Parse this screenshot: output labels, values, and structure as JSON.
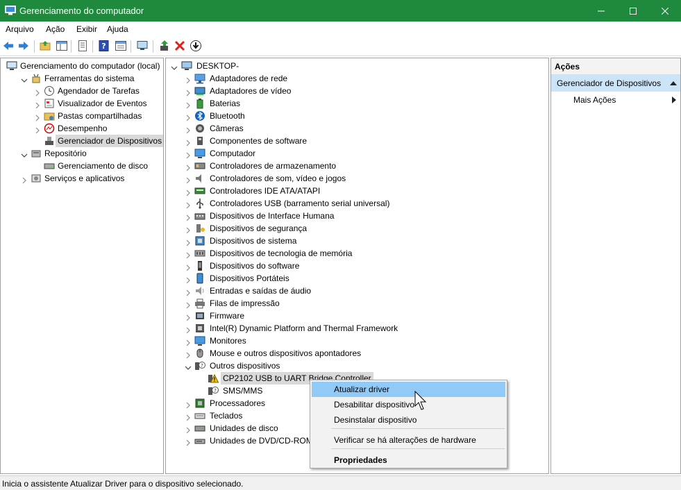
{
  "window": {
    "title": "Gerenciamento do computador",
    "controls": [
      "minimize-icon",
      "maximize-icon",
      "close-icon"
    ]
  },
  "menu": [
    "Arquivo",
    "Ação",
    "Exibir",
    "Ajuda"
  ],
  "toolbar": [
    "back-icon",
    "forward-icon",
    "up-folder-icon",
    "show-hide-tree-icon",
    "export-list-icon",
    "help-icon",
    "properties-icon",
    "scan-monitor-icon",
    "update-driver-icon",
    "uninstall-icon",
    "download-icon"
  ],
  "left_tree": {
    "items": [
      {
        "label": "Gerenciamento do computador (local)",
        "level": 0,
        "chevron": "none",
        "icon": "computer-management-icon"
      },
      {
        "label": "Ferramentas do sistema",
        "level": 1,
        "chevron": "expanded",
        "icon": "tools-icon"
      },
      {
        "label": "Agendador de Tarefas",
        "level": 2,
        "chevron": "collapsed",
        "icon": "clock-icon"
      },
      {
        "label": "Visualizador de Eventos",
        "level": 2,
        "chevron": "collapsed",
        "icon": "event-viewer-icon"
      },
      {
        "label": "Pastas compartilhadas",
        "level": 2,
        "chevron": "collapsed",
        "icon": "shared-folder-icon"
      },
      {
        "label": "Desempenho",
        "level": 2,
        "chevron": "collapsed",
        "icon": "performance-icon"
      },
      {
        "label": "Gerenciador de Dispositivos",
        "level": 2,
        "chevron": "none",
        "icon": "device-manager-icon",
        "selected": true
      },
      {
        "label": "Repositório",
        "level": 1,
        "chevron": "expanded",
        "icon": "storage-icon"
      },
      {
        "label": "Gerenciamento de disco",
        "level": 2,
        "chevron": "none",
        "icon": "disk-icon"
      },
      {
        "label": "Serviços e aplicativos",
        "level": 1,
        "chevron": "collapsed",
        "icon": "services-icon"
      }
    ]
  },
  "device_tree": {
    "root": "DESKTOP-",
    "items": [
      {
        "label": "Adaptadores de rede",
        "level": 1,
        "chevron": "collapsed",
        "icon": "network-adapter-icon"
      },
      {
        "label": "Adaptadores de vídeo",
        "level": 1,
        "chevron": "collapsed",
        "icon": "display-adapter-icon"
      },
      {
        "label": "Baterias",
        "level": 1,
        "chevron": "collapsed",
        "icon": "battery-icon"
      },
      {
        "label": "Bluetooth",
        "level": 1,
        "chevron": "collapsed",
        "icon": "bluetooth-icon"
      },
      {
        "label": "Câmeras",
        "level": 1,
        "chevron": "collapsed",
        "icon": "camera-icon"
      },
      {
        "label": "Componentes de software",
        "level": 1,
        "chevron": "collapsed",
        "icon": "software-component-icon"
      },
      {
        "label": "Computador",
        "level": 1,
        "chevron": "collapsed",
        "icon": "monitor-icon"
      },
      {
        "label": "Controladores de armazenamento",
        "level": 1,
        "chevron": "collapsed",
        "icon": "storage-controller-icon"
      },
      {
        "label": "Controladores de som, vídeo e jogos",
        "level": 1,
        "chevron": "collapsed",
        "icon": "speaker-icon"
      },
      {
        "label": "Controladores IDE ATA/ATAPI",
        "level": 1,
        "chevron": "collapsed",
        "icon": "ide-controller-icon"
      },
      {
        "label": "Controladores USB (barramento serial universal)",
        "level": 1,
        "chevron": "collapsed",
        "icon": "usb-icon"
      },
      {
        "label": "Dispositivos de Interface Humana",
        "level": 1,
        "chevron": "collapsed",
        "icon": "hid-icon"
      },
      {
        "label": "Dispositivos de segurança",
        "level": 1,
        "chevron": "collapsed",
        "icon": "security-device-icon"
      },
      {
        "label": "Dispositivos de sistema",
        "level": 1,
        "chevron": "collapsed",
        "icon": "system-device-icon"
      },
      {
        "label": "Dispositivos de tecnologia de memória",
        "level": 1,
        "chevron": "collapsed",
        "icon": "memory-device-icon"
      },
      {
        "label": "Dispositivos do software",
        "level": 1,
        "chevron": "collapsed",
        "icon": "software-device-icon"
      },
      {
        "label": "Dispositivos Portáteis",
        "level": 1,
        "chevron": "collapsed",
        "icon": "portable-device-icon"
      },
      {
        "label": "Entradas e saídas de áudio",
        "level": 1,
        "chevron": "collapsed",
        "icon": "audio-io-icon"
      },
      {
        "label": "Filas de impressão",
        "level": 1,
        "chevron": "collapsed",
        "icon": "printer-icon"
      },
      {
        "label": "Firmware",
        "level": 1,
        "chevron": "collapsed",
        "icon": "firmware-icon"
      },
      {
        "label": "Intel(R) Dynamic Platform and Thermal Framework",
        "level": 1,
        "chevron": "collapsed",
        "icon": "thermal-framework-icon"
      },
      {
        "label": "Monitores",
        "level": 1,
        "chevron": "collapsed",
        "icon": "monitor-icon"
      },
      {
        "label": "Mouse e outros dispositivos apontadores",
        "level": 1,
        "chevron": "collapsed",
        "icon": "mouse-icon"
      },
      {
        "label": "Outros dispositivos",
        "level": 1,
        "chevron": "expanded",
        "icon": "unknown-device-icon"
      },
      {
        "label": "CP2102 USB to UART Bridge Controller",
        "level": 2,
        "chevron": "none",
        "icon": "warning-device-icon",
        "selected": true
      },
      {
        "label": "SMS/MMS",
        "level": 2,
        "chevron": "none",
        "icon": "unknown-device-icon"
      },
      {
        "label": "Processadores",
        "level": 1,
        "chevron": "collapsed",
        "icon": "processor-icon"
      },
      {
        "label": "Teclados",
        "level": 1,
        "chevron": "collapsed",
        "icon": "keyboard-icon"
      },
      {
        "label": "Unidades de disco",
        "level": 1,
        "chevron": "collapsed",
        "icon": "disk-drive-icon"
      },
      {
        "label": "Unidades de DVD/CD-ROM",
        "level": 1,
        "chevron": "collapsed",
        "icon": "dvd-drive-icon"
      }
    ]
  },
  "actions": {
    "header": "Ações",
    "section": "Gerenciador de Dispositivos",
    "more": "Mais Ações"
  },
  "context_menu": {
    "items": [
      {
        "label": "Atualizar driver",
        "highlighted": true
      },
      {
        "label": "Desabilitar dispositivo"
      },
      {
        "label": "Desinstalar dispositivo"
      },
      {
        "label": "Verificar se há alterações de hardware"
      },
      {
        "label": "Propriedades",
        "bold": true
      }
    ]
  },
  "status_bar": "Inicia o assistente Atualizar Driver para o dispositivo selecionado.",
  "colors": {
    "title_bar": "#1f8a3d",
    "selection": "#d9d9d9",
    "menu_highlight": "#91c9f7",
    "actions_section": "#cce4f7"
  }
}
